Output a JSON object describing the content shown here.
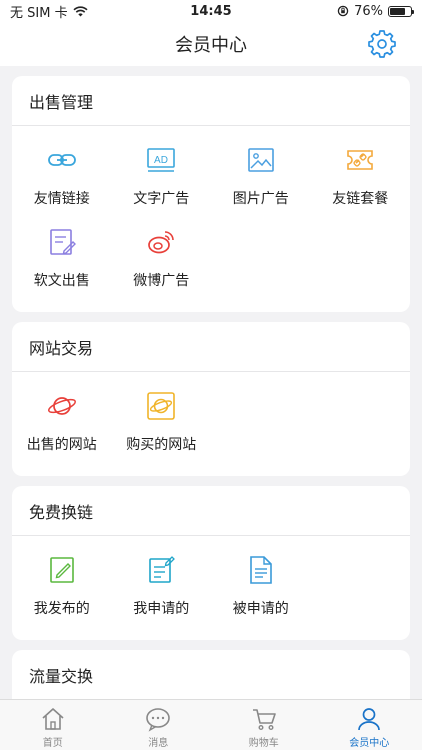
{
  "status_bar": {
    "carrier": "无 SIM 卡",
    "time": "14:45",
    "battery": "76%",
    "battery_level": 0.76
  },
  "nav": {
    "title": "会员中心"
  },
  "sections": [
    {
      "title": "出售管理",
      "items": [
        {
          "label": "友情链接",
          "icon": "link-icon",
          "color": "#3aa6dc"
        },
        {
          "label": "文字广告",
          "icon": "ad-text-icon",
          "color": "#3aa6dc",
          "glyph": "AD"
        },
        {
          "label": "图片广告",
          "icon": "image-icon",
          "color": "#4a9fe0"
        },
        {
          "label": "友链套餐",
          "icon": "ticket-link-icon",
          "color": "#f3a93c"
        },
        {
          "label": "软文出售",
          "icon": "edit-document-icon",
          "color": "#8b7fe0"
        },
        {
          "label": "微博广告",
          "icon": "weibo-icon",
          "color": "#e8403a"
        }
      ]
    },
    {
      "title": "网站交易",
      "items": [
        {
          "label": "出售的网站",
          "icon": "planet-icon",
          "color": "#e8403a"
        },
        {
          "label": "购买的网站",
          "icon": "planet-frame-icon",
          "color": "#f0b429"
        }
      ]
    },
    {
      "title": "免费换链",
      "items": [
        {
          "label": "我发布的",
          "icon": "publish-edit-icon",
          "color": "#5ab83e"
        },
        {
          "label": "我申请的",
          "icon": "apply-edit-icon",
          "color": "#1fa5c9"
        },
        {
          "label": "被申请的",
          "icon": "document-icon",
          "color": "#3a9ad9"
        }
      ]
    },
    {
      "title": "流量交换",
      "items": []
    }
  ],
  "tabs": [
    {
      "label": "首页",
      "icon": "home-icon",
      "active": false
    },
    {
      "label": "消息",
      "icon": "message-icon",
      "active": false
    },
    {
      "label": "购物车",
      "icon": "cart-icon",
      "active": false
    },
    {
      "label": "会员中心",
      "icon": "user-icon",
      "active": true
    }
  ],
  "colors": {
    "accent": "#1a73c8",
    "inactive": "#888888"
  }
}
